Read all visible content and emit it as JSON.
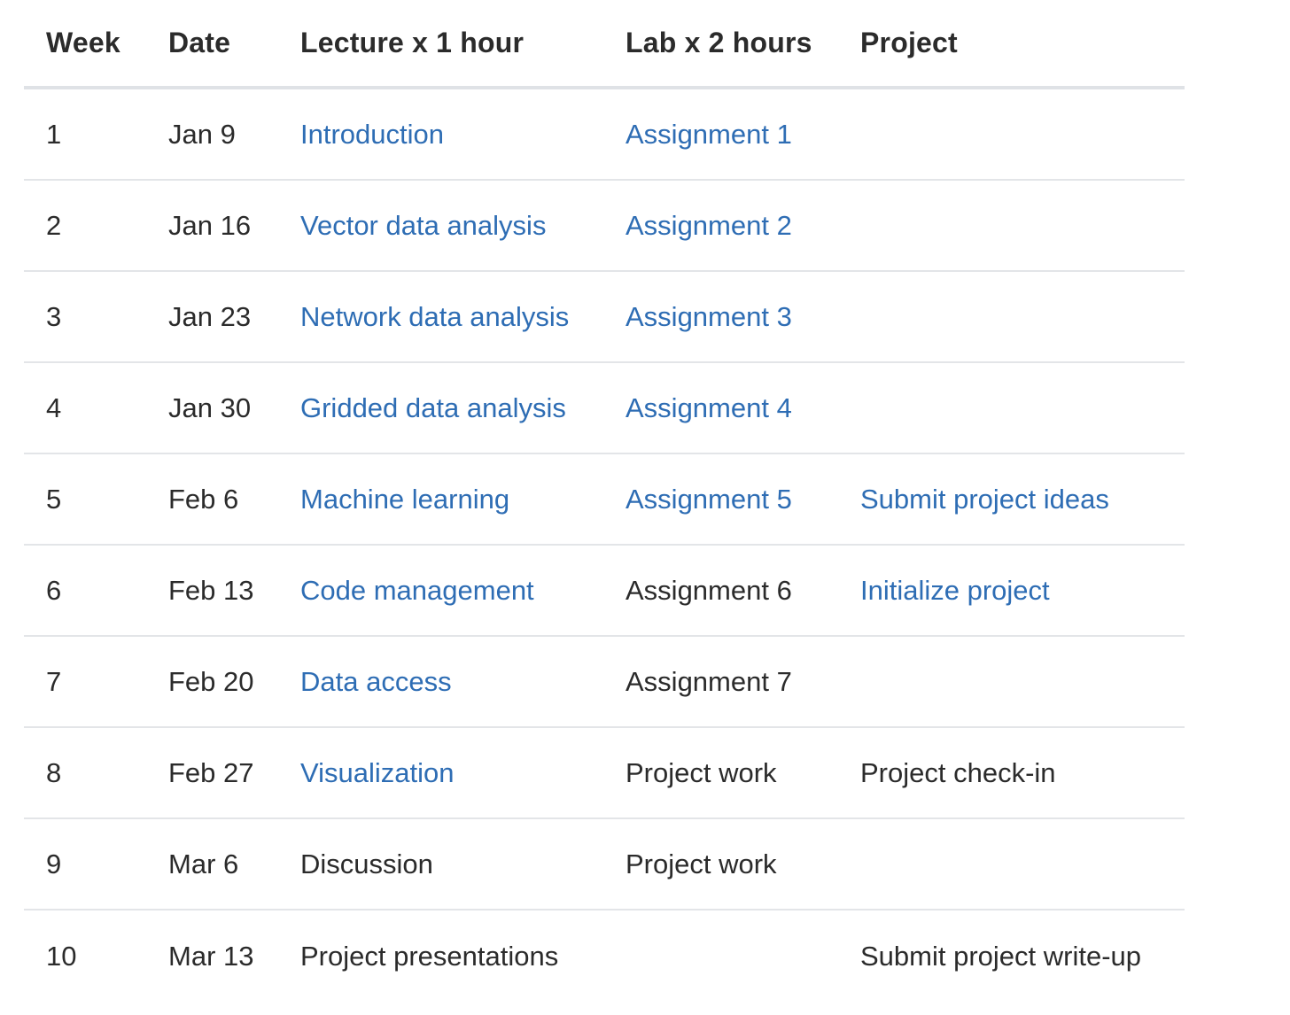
{
  "table": {
    "headers": {
      "week": "Week",
      "date": "Date",
      "lecture": "Lecture x 1 hour",
      "lab": "Lab x 2 hours",
      "project": "Project"
    },
    "rows": [
      {
        "week": "1",
        "date": "Jan 9",
        "lecture": "Introduction",
        "lab": "Assignment 1",
        "project": ""
      },
      {
        "week": "2",
        "date": "Jan 16",
        "lecture": "Vector data analysis",
        "lab": "Assignment 2",
        "project": ""
      },
      {
        "week": "3",
        "date": "Jan 23",
        "lecture": "Network data analysis",
        "lab": "Assignment 3",
        "project": ""
      },
      {
        "week": "4",
        "date": "Jan 30",
        "lecture": "Gridded data analysis",
        "lab": "Assignment 4",
        "project": ""
      },
      {
        "week": "5",
        "date": "Feb 6",
        "lecture": "Machine learning",
        "lab": "Assignment 5",
        "project": "Submit project ideas"
      },
      {
        "week": "6",
        "date": "Feb 13",
        "lecture": "Code management",
        "lab": "Assignment 6",
        "project": "Initialize project"
      },
      {
        "week": "7",
        "date": "Feb 20",
        "lecture": "Data access",
        "lab": "Assignment 7",
        "project": ""
      },
      {
        "week": "8",
        "date": "Feb 27",
        "lecture": "Visualization",
        "lab": "Project work",
        "project": "Project check-in"
      },
      {
        "week": "9",
        "date": "Mar 6",
        "lecture": "Discussion",
        "lab": "Project work",
        "project": ""
      },
      {
        "week": "10",
        "date": "Mar 13",
        "lecture": "Project presentations",
        "lab": "",
        "project": "Submit project write-up"
      }
    ]
  },
  "colors": {
    "link": "#2e6db4",
    "text": "#2b2b2b",
    "header_rule": "#dfe2e6",
    "row_rule": "#e3e5e8"
  }
}
